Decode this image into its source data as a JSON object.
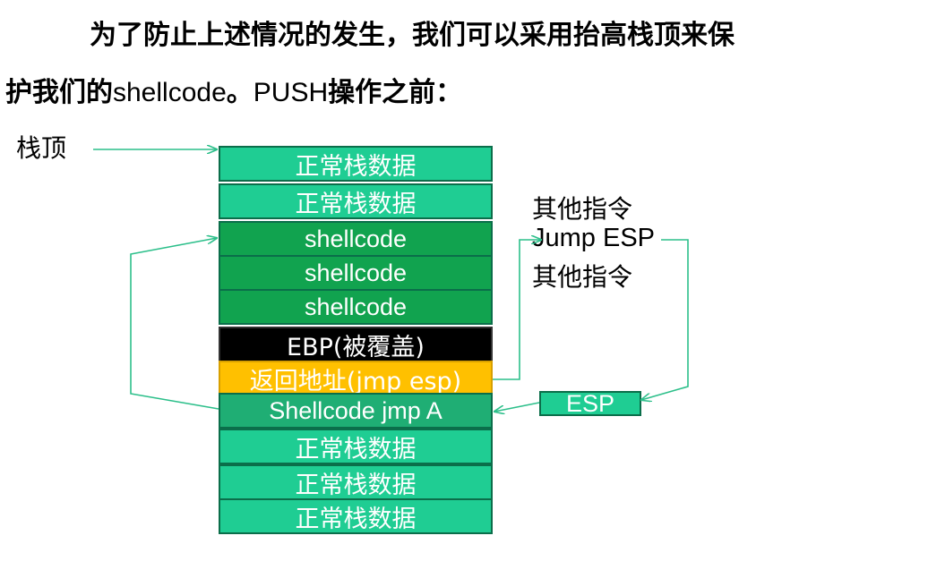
{
  "paragraph": {
    "line1": "为了防止上述情况的发生，我们可以采用抬高栈顶来保",
    "line2_a": "护我们的",
    "line2_b": "shellcode",
    "line2_c": "。",
    "line2_d": "PUSH",
    "line2_e": "操作之前："
  },
  "labels": {
    "stack_top": "栈顶",
    "other_instr_1": "其他指令",
    "jump_esp": "Jump ESP",
    "other_instr_2": "其他指令",
    "esp": "ESP"
  },
  "stack": [
    {
      "label": "正常栈数据",
      "kind": "normal"
    },
    {
      "label": "正常栈数据",
      "kind": "normal"
    },
    {
      "label": "shellcode",
      "kind": "shell"
    },
    {
      "label": "shellcode",
      "kind": "shell"
    },
    {
      "label": "shellcode",
      "kind": "shell"
    },
    {
      "label": "EBP(被覆盖)",
      "kind": "ebp"
    },
    {
      "label": "返回地址(jmp esp)",
      "kind": "ret"
    },
    {
      "label": "Shellcode jmp A",
      "kind": "jmp"
    },
    {
      "label": "正常栈数据",
      "kind": "normal"
    },
    {
      "label": "正常栈数据",
      "kind": "normal"
    },
    {
      "label": "正常栈数据",
      "kind": "normal"
    }
  ],
  "colors": {
    "normal": "#1fcd93",
    "shellcode": "#11a34f",
    "ebp": "#000000",
    "return_address": "#ffc000",
    "arrow": "#2cbf8a"
  }
}
